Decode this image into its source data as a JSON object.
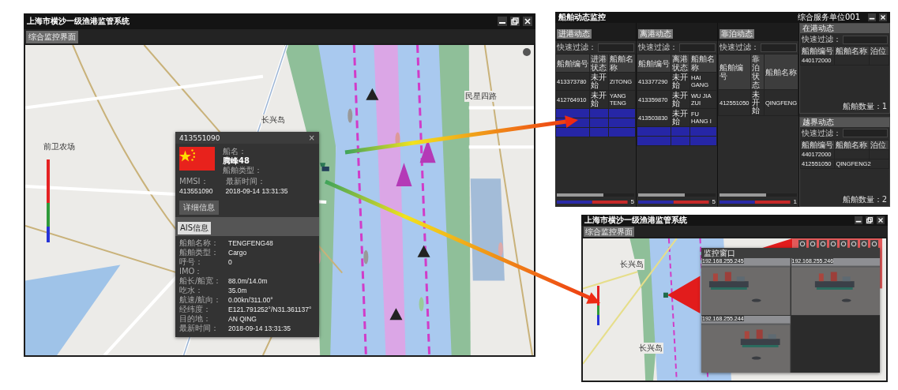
{
  "main_window": {
    "title": "上海市横沙一级渔港监管系统",
    "tab": "综合监控界面",
    "map_labels": [
      {
        "text": "长兴岛"
      },
      {
        "text": "前卫农场"
      },
      {
        "text": "民星四路"
      }
    ],
    "popup": {
      "title": "413551090",
      "close": "×",
      "name_label": "船名：",
      "name": "腾峰48",
      "type_label": "船舶类型：",
      "mmsi_label": "MMSI：",
      "mmsi": "413551090",
      "time_label": "最新时间：",
      "time": "2018-09-14 13:31:35",
      "button": "详细信息",
      "section_tab": "AIS信息",
      "fields": [
        {
          "label": "船舶名称：",
          "value": "TENGFENG48"
        },
        {
          "label": "船舶类型：",
          "value": "Cargo"
        },
        {
          "label": "呼号：",
          "value": "0"
        },
        {
          "label": "IMO："
        },
        {
          "label": "船长/船宽：",
          "value": "88.0m/14.0m"
        },
        {
          "label": "吃水：",
          "value": "35.0m"
        },
        {
          "label": "航速/航向：",
          "value": "0.00kn/311.00°"
        },
        {
          "label": "经纬度：",
          "value": "E121.791252°/N31.361137°"
        },
        {
          "label": "目的地：",
          "value": "AN QING"
        },
        {
          "label": "最新时间：",
          "value": "2018-09-14 13:31:35"
        }
      ]
    }
  },
  "dynamics_window": {
    "title": "船舶动态监控",
    "unit": "综合服务单位001",
    "panels": [
      {
        "title": "进港动态",
        "filter_label": "快速过滤：",
        "columns": [
          "船舶编号",
          "进港状态",
          "船舶名称"
        ],
        "rows": [
          {
            "cells": [
              "413373780",
              "未开始",
              "ZITONG"
            ],
            "highlighted": false
          },
          {
            "cells": [
              "412764910",
              "未开始",
              "YANG TENG"
            ],
            "highlighted": false
          },
          {
            "highlighted": true
          },
          {
            "highlighted": true
          },
          {
            "highlighted": true
          }
        ],
        "count": "5"
      },
      {
        "title": "离港动态",
        "filter_label": "快速过滤：",
        "columns": [
          "船舶编号",
          "离港状态",
          "船舶名称"
        ],
        "rows": [
          {
            "cells": [
              "413377290",
              "未开始",
              "HAI GANG"
            ],
            "highlighted": false
          },
          {
            "cells": [
              "413359870",
              "未开始",
              "WU JIA ZUI"
            ],
            "highlighted": false
          },
          {
            "cells": [
              "413503830",
              "未开始",
              "FU HANG I"
            ],
            "highlighted": false
          },
          {
            "highlighted": true
          },
          {
            "highlighted": true
          }
        ],
        "count": "5"
      },
      {
        "title": "靠泊动态",
        "filter_label": "快速过滤：",
        "columns": [
          "船舶编号",
          "靠泊状态",
          "船舶名称"
        ],
        "rows": [
          {
            "cells": [
              "412551050",
              "未开始",
              "QINGFENG"
            ],
            "highlighted": false
          }
        ],
        "count": "1"
      }
    ],
    "side_panels": [
      {
        "title": "在港动态",
        "filter_label": "快速过滤：",
        "columns": [
          "船舶编号",
          "船舶名称",
          "泊位"
        ],
        "rows": [
          {
            "cells": [
              "440172000"
            ]
          }
        ],
        "footer": "船舶数量：1"
      },
      {
        "title": "越界动态",
        "filter_label": "快速过滤：",
        "columns": [
          "船舶编号",
          "船舶名称",
          "泊位"
        ],
        "rows": [
          {
            "cells": [
              "440172000"
            ]
          },
          {
            "cells": [
              "412551050",
              "QINGFENG2"
            ]
          }
        ],
        "footer": "船舶数量：2"
      }
    ]
  },
  "video_window": {
    "title": "上海市横沙一级渔港监管系统",
    "tab": "综合监控界面",
    "map_labels": [
      {
        "text": "长兴岛"
      },
      {
        "text": "长兴岛"
      }
    ],
    "monitor": {
      "title": "监控窗口",
      "feeds": [
        {
          "label": "192.168.255.245"
        },
        {
          "label": "192.168.255.246"
        },
        {
          "label": "192.168.255.244"
        }
      ]
    }
  }
}
